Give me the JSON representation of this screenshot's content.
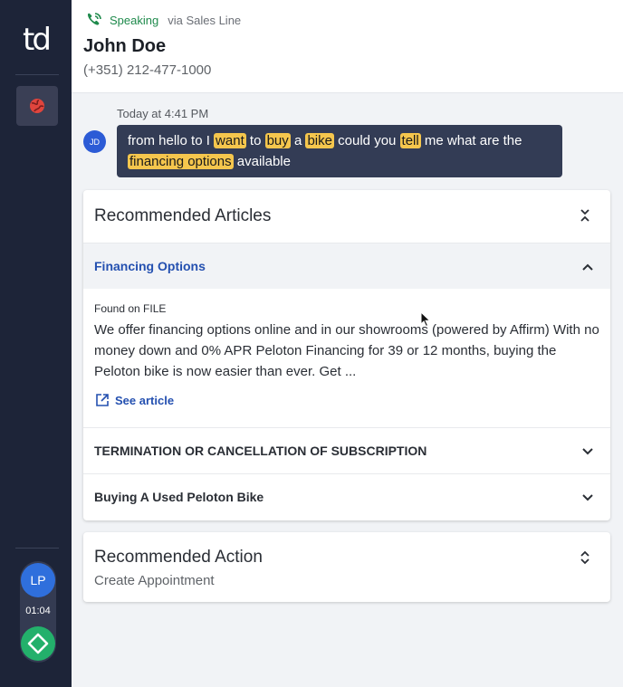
{
  "sidebar": {
    "logo": "td",
    "agent_initials": "LP",
    "call_timer": "01:04"
  },
  "header": {
    "status": "Speaking",
    "via": "via Sales Line",
    "caller_name": "John Doe",
    "caller_phone": "(+351) 212-477-1000"
  },
  "transcript": {
    "timestamp": "Today at 4:41 PM",
    "avatar_initials": "JD",
    "segments": [
      {
        "text": "from hello to I ",
        "hl": false
      },
      {
        "text": "want",
        "hl": true
      },
      {
        "text": " to ",
        "hl": false
      },
      {
        "text": "buy",
        "hl": true
      },
      {
        "text": " a ",
        "hl": false
      },
      {
        "text": "bike",
        "hl": true
      },
      {
        "text": " could you ",
        "hl": false
      },
      {
        "text": "tell",
        "hl": true
      },
      {
        "text": " me what are the ",
        "hl": false
      },
      {
        "text": "financing options",
        "hl": true
      },
      {
        "text": " available",
        "hl": false
      }
    ]
  },
  "recommended_articles": {
    "title": "Recommended Articles",
    "expanded": {
      "title": "Financing Options",
      "source": "Found on FILE",
      "snippet": "We offer financing options online and in our showrooms (powered by Affirm) With no money down and 0% APR Peloton Financing for 39 or 12 months, buying the Peloton bike is now easier than ever. Get ...",
      "link_label": "See article"
    },
    "collapsed": [
      "TERMINATION OR CANCELLATION OF SUBSCRIPTION",
      "Buying A Used Peloton Bike"
    ]
  },
  "recommended_action": {
    "title": "Recommended Action",
    "subtitle": "Create Appointment"
  },
  "colors": {
    "sidebar_bg": "#1d2438",
    "bubble_bg": "#333c55",
    "highlight": "#f5c64d",
    "accent_blue": "#2450b0",
    "status_green": "#1f8a4c"
  }
}
